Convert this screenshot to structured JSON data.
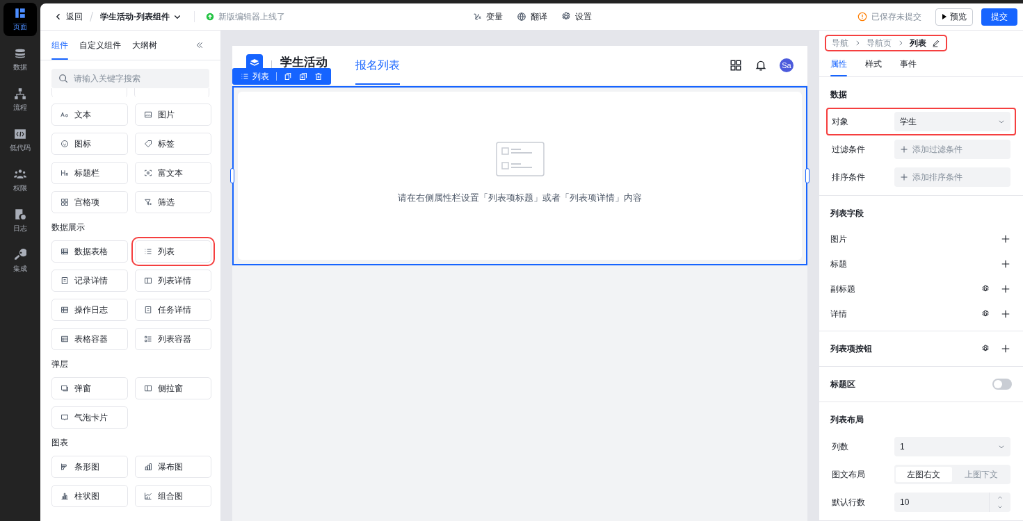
{
  "rail": [
    {
      "label": "页面",
      "selected": true
    },
    {
      "label": "数据",
      "selected": false
    },
    {
      "label": "流程",
      "selected": false
    },
    {
      "label": "低代码",
      "selected": false
    },
    {
      "label": "权限",
      "selected": false
    },
    {
      "label": "日志",
      "selected": false
    },
    {
      "label": "集成",
      "selected": false
    }
  ],
  "topbar": {
    "back": "返回",
    "app_title": "学生活动-列表组件",
    "notice": "新版编辑器上线了",
    "tools": [
      "变量",
      "翻译",
      "设置"
    ],
    "save_status": "已保存未提交",
    "preview": "预览",
    "submit": "提交"
  },
  "left_panel": {
    "tabs": [
      {
        "label": "组件",
        "selected": true
      },
      {
        "label": "自定义组件",
        "selected": false
      },
      {
        "label": "大纲树",
        "selected": false
      }
    ],
    "search": {
      "placeholder": "请输入关键字搜索"
    },
    "groups": [
      {
        "items": [
          {
            "label": "文本",
            "highlighted": false
          },
          {
            "label": "图片",
            "highlighted": false
          },
          {
            "label": "图标",
            "highlighted": false
          },
          {
            "label": "标签",
            "highlighted": false
          },
          {
            "label": "标题栏",
            "highlighted": false
          },
          {
            "label": "富文本",
            "highlighted": false
          },
          {
            "label": "宫格项",
            "highlighted": false
          },
          {
            "label": "筛选",
            "highlighted": false
          }
        ]
      },
      {
        "title": "数据展示",
        "items": [
          {
            "label": "数据表格",
            "highlighted": false
          },
          {
            "label": "列表",
            "highlighted": true
          },
          {
            "label": "记录详情",
            "highlighted": false
          },
          {
            "label": "列表详情",
            "highlighted": false
          },
          {
            "label": "操作日志",
            "highlighted": false
          },
          {
            "label": "任务详情",
            "highlighted": false
          },
          {
            "label": "表格容器",
            "highlighted": false
          },
          {
            "label": "列表容器",
            "highlighted": false
          }
        ]
      },
      {
        "title": "弹层",
        "items": [
          {
            "label": "弹窗",
            "highlighted": false
          },
          {
            "label": "侧拉窗",
            "highlighted": false
          },
          {
            "label": "气泡卡片",
            "highlighted": false
          }
        ]
      },
      {
        "title": "图表",
        "items": [
          {
            "label": "条形图",
            "highlighted": false
          },
          {
            "label": "瀑布图",
            "highlighted": false
          },
          {
            "label": "柱状图",
            "highlighted": false
          },
          {
            "label": "组合图",
            "highlighted": false
          }
        ]
      }
    ]
  },
  "canvas": {
    "app_name": "学生活动",
    "page_tab": "报名列表",
    "avatar": "Sa",
    "toolbar_label": "列表",
    "empty_text": "请在右侧属性栏设置「列表项标题」或者「列表项详情」内容"
  },
  "right_panel": {
    "breadcrumb": {
      "items": [
        "导航",
        "导航页",
        "列表"
      ],
      "highlighted": true
    },
    "tabs": [
      {
        "label": "属性",
        "selected": true
      },
      {
        "label": "样式",
        "selected": false
      },
      {
        "label": "事件",
        "selected": false
      }
    ],
    "sections": [
      {
        "title": "数据",
        "kind": "form",
        "rows": [
          {
            "kind": "select",
            "label": "对象",
            "value": "学生",
            "highlighted": true
          },
          {
            "kind": "add",
            "label": "过滤条件",
            "value": "添加过滤条件",
            "highlighted": false
          },
          {
            "kind": "add",
            "label": "排序条件",
            "value": "添加排序条件",
            "highlighted": false
          }
        ]
      },
      {
        "title": "列表字段",
        "kind": "form",
        "rows": [
          {
            "kind": "field",
            "label": "图片",
            "settings": false
          },
          {
            "kind": "field",
            "label": "标题",
            "settings": false
          },
          {
            "kind": "field",
            "label": "副标题",
            "settings": true
          },
          {
            "kind": "field",
            "label": "详情",
            "settings": true
          }
        ]
      },
      {
        "title": "列表项按钮",
        "kind": "action",
        "settings": true
      },
      {
        "title": "标题区",
        "kind": "toggle",
        "on": false
      },
      {
        "title": "列表布局",
        "kind": "form",
        "rows": [
          {
            "kind": "select",
            "label": "列数",
            "value": "1",
            "highlighted": false
          },
          {
            "kind": "segmented",
            "label": "图文布局",
            "options": [
              {
                "label": "左图右文",
                "selected": true
              },
              {
                "label": "上图下文",
                "selected": false
              }
            ]
          },
          {
            "kind": "number",
            "label": "默认行数",
            "value": "10"
          }
        ]
      }
    ]
  }
}
